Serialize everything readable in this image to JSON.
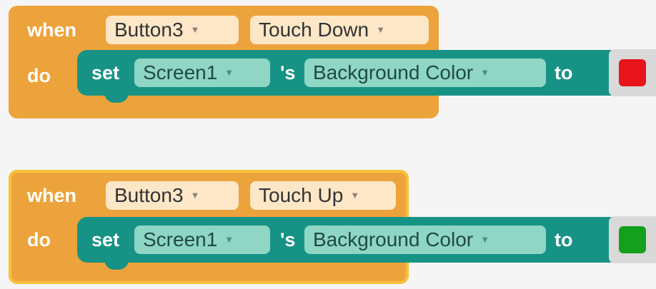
{
  "blocks": [
    {
      "when_label": "when",
      "component": "Button3",
      "event": "Touch Down",
      "do_label": "do",
      "set_label": "set",
      "target": "Screen1",
      "possessive": "'s",
      "property": "Background Color",
      "to_label": "to",
      "color": "#e8141b",
      "selected": false
    },
    {
      "when_label": "when",
      "component": "Button3",
      "event": "Touch Up",
      "do_label": "do",
      "set_label": "set",
      "target": "Screen1",
      "possessive": "'s",
      "property": "Background Color",
      "to_label": "to",
      "color": "#13a11d",
      "selected": true
    }
  ],
  "icons": {
    "dropdown": "chevron-down-icon",
    "color_swatch": "color-swatch-icon"
  }
}
